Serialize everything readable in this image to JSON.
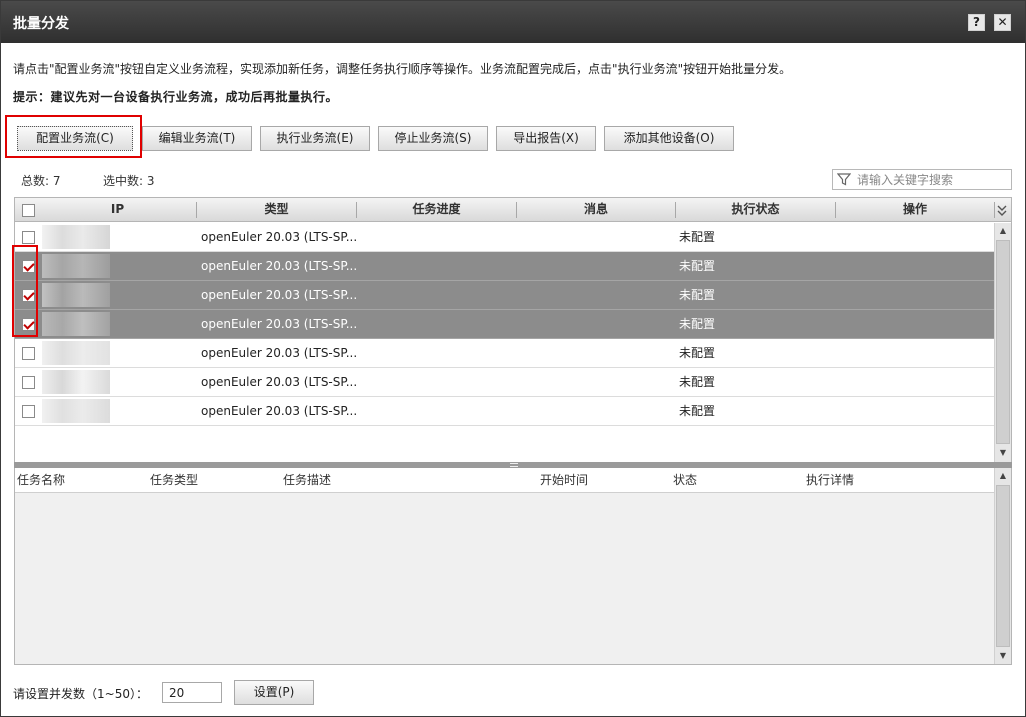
{
  "window": {
    "title": "批量分发",
    "help_label": "?",
    "close_label": "✕"
  },
  "instructions": "请点击\"配置业务流\"按钮自定义业务流程，实现添加新任务，调整任务执行顺序等操作。业务流配置完成后，点击\"执行业务流\"按钮开始批量分发。",
  "tip": "提示：建议先对一台设备执行业务流，成功后再批量执行。",
  "toolbar": {
    "config_workflow": "配置业务流(C)",
    "edit_workflow": "编辑业务流(T)",
    "run_workflow": "执行业务流(E)",
    "stop_workflow": "停止业务流(S)",
    "export_report": "导出报告(X)",
    "add_devices": "添加其他设备(O)"
  },
  "stats": {
    "total": "总数: 7",
    "selected": "选中数: 3"
  },
  "search": {
    "placeholder": "请输入关键字搜索"
  },
  "device_table": {
    "columns": [
      "IP",
      "类型",
      "任务进度",
      "消息",
      "执行状态",
      "操作"
    ],
    "rows": [
      {
        "checked": false,
        "type": "openEuler 20.03 (LTS-SP...",
        "status": "未配置"
      },
      {
        "checked": true,
        "type": "openEuler 20.03 (LTS-SP...",
        "status": "未配置"
      },
      {
        "checked": true,
        "type": "openEuler 20.03 (LTS-SP...",
        "status": "未配置"
      },
      {
        "checked": true,
        "type": "openEuler 20.03 (LTS-SP...",
        "status": "未配置"
      },
      {
        "checked": false,
        "type": "openEuler 20.03 (LTS-SP...",
        "status": "未配置"
      },
      {
        "checked": false,
        "type": "openEuler 20.03 (LTS-SP...",
        "status": "未配置"
      },
      {
        "checked": false,
        "type": "openEuler 20.03 (LTS-SP...",
        "status": "未配置"
      }
    ]
  },
  "task_table": {
    "columns": [
      "任务名称",
      "任务类型",
      "任务描述",
      "开始时间",
      "状态",
      "执行详情"
    ]
  },
  "concurrency": {
    "label": "请设置并发数（1~50）：",
    "value": "20",
    "set_label": "设置(P)"
  },
  "colors": {
    "titlebar": "#3a3a3a",
    "selected_row": "#8c8c8c",
    "highlight": "#e00000"
  }
}
